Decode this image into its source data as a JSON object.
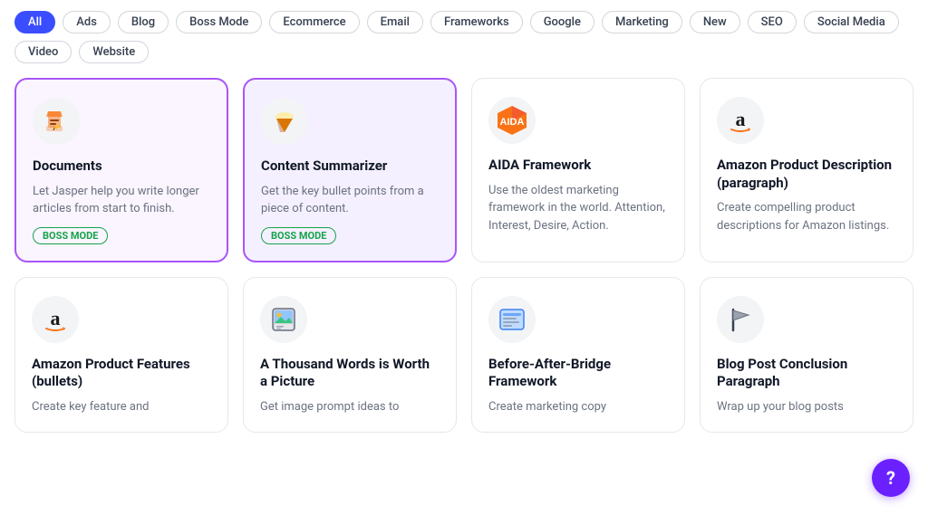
{
  "filters": [
    {
      "label": "All",
      "active": true
    },
    {
      "label": "Ads",
      "active": false
    },
    {
      "label": "Blog",
      "active": false
    },
    {
      "label": "Boss Mode",
      "active": false
    },
    {
      "label": "Ecommerce",
      "active": false
    },
    {
      "label": "Email",
      "active": false
    },
    {
      "label": "Frameworks",
      "active": false
    },
    {
      "label": "Google",
      "active": false
    },
    {
      "label": "Marketing",
      "active": false
    },
    {
      "label": "New",
      "active": false
    },
    {
      "label": "SEO",
      "active": false
    },
    {
      "label": "Social Media",
      "active": false
    },
    {
      "label": "Video",
      "active": false
    },
    {
      "label": "Website",
      "active": false
    }
  ],
  "cards_row1": [
    {
      "id": "documents",
      "icon_type": "pencil",
      "title": "Documents",
      "desc": "Let Jasper help you write longer articles from start to finish.",
      "badge": "BOSS MODE",
      "badge_type": "green",
      "style": "selected-purple"
    },
    {
      "id": "content-summarizer",
      "icon_type": "cone",
      "title": "Content Summarizer",
      "desc": "Get the key bullet points from a piece of content.",
      "badge": "BOSS MODE",
      "badge_type": "green",
      "style": "selected-purple-light"
    },
    {
      "id": "aida-framework",
      "icon_type": "aida",
      "title": "AIDA Framework",
      "desc": "Use the oldest marketing framework in the world. Attention, Interest, Desire, Action.",
      "badge": "",
      "badge_type": "",
      "style": ""
    },
    {
      "id": "amazon-product-desc",
      "icon_type": "amazon",
      "title": "Amazon Product Description (paragraph)",
      "desc": "Create compelling product descriptions for Amazon listings.",
      "badge": "",
      "badge_type": "",
      "style": ""
    }
  ],
  "cards_row2": [
    {
      "id": "amazon-product-features",
      "icon_type": "amazon",
      "title": "Amazon Product Features (bullets)",
      "desc": "Create key feature and",
      "badge": "",
      "badge_type": "",
      "style": ""
    },
    {
      "id": "thousand-words",
      "icon_type": "picture",
      "title": "A Thousand Words is Worth a Picture",
      "desc": "Get image prompt ideas to",
      "badge": "",
      "badge_type": "",
      "style": ""
    },
    {
      "id": "before-after-bridge",
      "icon_type": "bab",
      "title": "Before-After-Bridge Framework",
      "desc": "Create marketing copy",
      "badge": "",
      "badge_type": "",
      "style": ""
    },
    {
      "id": "blog-post-conclusion",
      "icon_type": "flag",
      "title": "Blog Post Conclusion Paragraph",
      "desc": "Wrap up your blog posts",
      "badge": "",
      "badge_type": "",
      "style": ""
    }
  ],
  "help_button_label": "?"
}
